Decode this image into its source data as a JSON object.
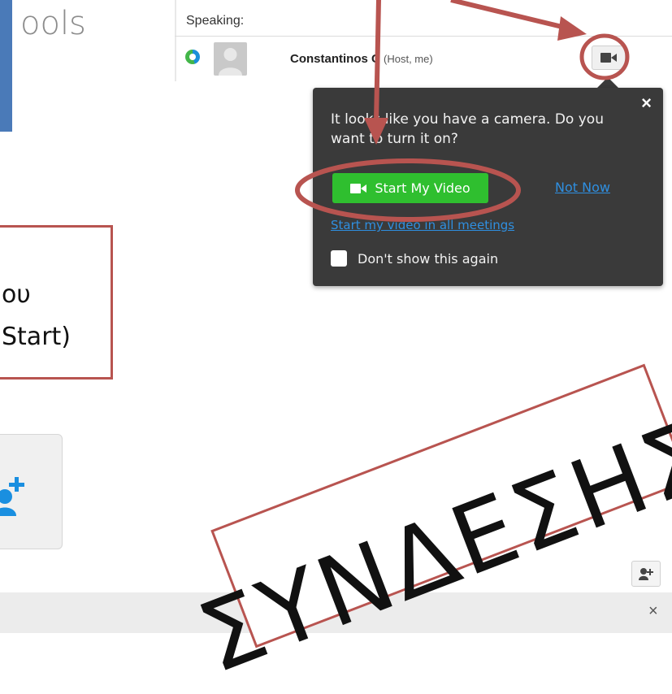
{
  "left_panel": {
    "tools_text": "ools"
  },
  "participants": {
    "speaking_label": "Speaking:",
    "row": {
      "name": "Constantinos C",
      "role": "(Host, me)",
      "camera_icon": "camera-icon",
      "status_icon": "presence-icon"
    }
  },
  "popup": {
    "message": "It looks like you have a camera. Do you want to turn it on?",
    "start_button": "Start My Video",
    "not_now": "Not Now",
    "all_meetings_link": "Start my video in all meetings",
    "checkbox_label": "Don't show this again",
    "close": "×"
  },
  "annotation": {
    "line1": "ου",
    "line2": "Start)"
  },
  "stamp": {
    "text": "ΣΥΝΔΕΣΗΣ"
  },
  "bottom": {
    "close": "×"
  },
  "colors": {
    "accent_green": "#2fbf2f",
    "link_blue": "#2f8fe0",
    "annotation_red": "#b85450",
    "popup_bg": "#3a3a3a"
  }
}
